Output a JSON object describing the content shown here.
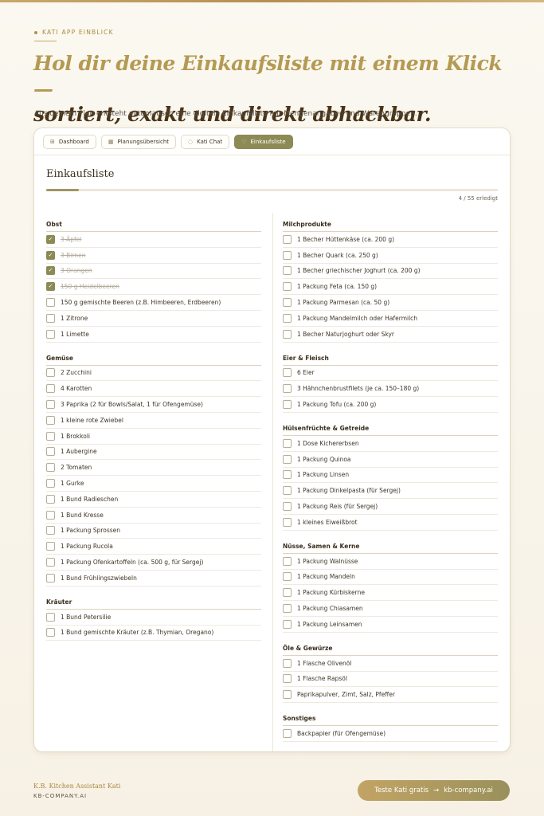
{
  "eyebrow": "KATI APP EINBLICK",
  "hero": {
    "line1": "Hol dir deine Einkaufsliste mit einem Klick —",
    "line2": "sortiert, exakt und direkt abhackbar.",
    "subtitle": "Aus deinem Plan entsteht automatisch eine digitale Einkaufsliste mit Mengenangaben und Warengruppen."
  },
  "tabs": [
    {
      "label": "Dashboard",
      "icon": "grid-icon",
      "glyph": "⊞",
      "active": false
    },
    {
      "label": "Planungsübersicht",
      "icon": "calendar-icon",
      "glyph": "▦",
      "active": false
    },
    {
      "label": "Kati Chat",
      "icon": "chat-icon",
      "glyph": "◌",
      "active": false
    },
    {
      "label": "Einkaufsliste",
      "icon": "cart-icon",
      "glyph": "♡",
      "active": true
    }
  ],
  "list": {
    "title": "Einkaufsliste",
    "progress_fraction": 0.0727,
    "progress_text": "4 / 55 erledigt"
  },
  "sections_left": [
    {
      "title": "Obst",
      "items": [
        {
          "label": "3 Äpfel",
          "checked": true
        },
        {
          "label": "3 Birnen",
          "checked": true
        },
        {
          "label": "3 Orangen",
          "checked": true
        },
        {
          "label": "150 g Heidelbeeren",
          "checked": true
        },
        {
          "label": "150 g gemischte Beeren (z.B. Himbeeren, Erdbeeren)",
          "checked": false
        },
        {
          "label": "1 Zitrone",
          "checked": false
        },
        {
          "label": "1 Limette",
          "checked": false
        }
      ]
    },
    {
      "title": "Gemüse",
      "items": [
        {
          "label": "2 Zucchini",
          "checked": false
        },
        {
          "label": "4 Karotten",
          "checked": false
        },
        {
          "label": "3 Paprika (2 für Bowls/Salat, 1 für Ofengemüse)",
          "checked": false
        },
        {
          "label": "1 kleine rote Zwiebel",
          "checked": false
        },
        {
          "label": "1 Brokkoli",
          "checked": false
        },
        {
          "label": "1 Aubergine",
          "checked": false
        },
        {
          "label": "2 Tomaten",
          "checked": false
        },
        {
          "label": "1 Gurke",
          "checked": false
        },
        {
          "label": "1 Bund Radieschen",
          "checked": false
        },
        {
          "label": "1 Bund Kresse",
          "checked": false
        },
        {
          "label": "1 Packung Sprossen",
          "checked": false
        },
        {
          "label": "1 Packung Rucola",
          "checked": false
        },
        {
          "label": "1 Packung Ofenkartoffeln (ca. 500 g, für Sergej)",
          "checked": false
        },
        {
          "label": "1 Bund Frühlingszwiebeln",
          "checked": false
        }
      ]
    },
    {
      "title": "Kräuter",
      "items": [
        {
          "label": "1 Bund Petersilie",
          "checked": false
        },
        {
          "label": "1 Bund gemischte Kräuter (z.B. Thymian, Oregano)",
          "checked": false
        }
      ]
    }
  ],
  "sections_right": [
    {
      "title": "Milchprodukte",
      "items": [
        {
          "label": "1 Becher Hüttenkäse (ca. 200 g)",
          "checked": false
        },
        {
          "label": "1 Becher Quark (ca. 250 g)",
          "checked": false
        },
        {
          "label": "1 Becher griechischer Joghurt (ca. 200 g)",
          "checked": false
        },
        {
          "label": "1 Packung Feta (ca. 150 g)",
          "checked": false
        },
        {
          "label": "1 Packung Parmesan (ca. 50 g)",
          "checked": false
        },
        {
          "label": "1 Packung Mandelmilch oder Hafermilch",
          "checked": false
        },
        {
          "label": "1 Becher Naturjoghurt oder Skyr",
          "checked": false
        }
      ]
    },
    {
      "title": "Eier & Fleisch",
      "items": [
        {
          "label": "6 Eier",
          "checked": false
        },
        {
          "label": "3 Hähnchenbrustfilets (je ca. 150–180 g)",
          "checked": false
        },
        {
          "label": "1 Packung Tofu (ca. 200 g)",
          "checked": false
        }
      ]
    },
    {
      "title": "Hülsenfrüchte & Getreide",
      "items": [
        {
          "label": "1 Dose Kichererbsen",
          "checked": false
        },
        {
          "label": "1 Packung Quinoa",
          "checked": false
        },
        {
          "label": "1 Packung Linsen",
          "checked": false
        },
        {
          "label": "1 Packung Dinkelpasta (für Sergej)",
          "checked": false
        },
        {
          "label": "1 Packung Reis (für Sergej)",
          "checked": false
        },
        {
          "label": "1 kleines Eiweißbrot",
          "checked": false
        }
      ]
    },
    {
      "title": "Nüsse, Samen & Kerne",
      "items": [
        {
          "label": "1 Packung Walnüsse",
          "checked": false
        },
        {
          "label": "1 Packung Mandeln",
          "checked": false
        },
        {
          "label": "1 Packung Kürbiskerne",
          "checked": false
        },
        {
          "label": "1 Packung Chiasamen",
          "checked": false
        },
        {
          "label": "1 Packung Leinsamen",
          "checked": false
        }
      ]
    },
    {
      "title": "Öle & Gewürze",
      "items": [
        {
          "label": "1 Flasche Olivenöl",
          "checked": false
        },
        {
          "label": "1 Flasche Rapsöl",
          "checked": false
        },
        {
          "label": "Paprikapulver, Zimt, Salz, Pfeffer",
          "checked": false
        }
      ]
    },
    {
      "title": "Sonstiges",
      "items": [
        {
          "label": "Backpapier (für Ofengemüse)",
          "checked": false
        }
      ]
    }
  ],
  "footer": {
    "brand": "K.B. Kitchen Assistant Kati",
    "domain": "KB-COMPANY.AI",
    "cta_label": "Teste Kati gratis",
    "cta_arrow": "→",
    "cta_domain": "kb-company.ai"
  },
  "colors": {
    "accent_gold": "#b49a52",
    "olive": "#8c8a55",
    "heading_brown": "#4a3418"
  }
}
